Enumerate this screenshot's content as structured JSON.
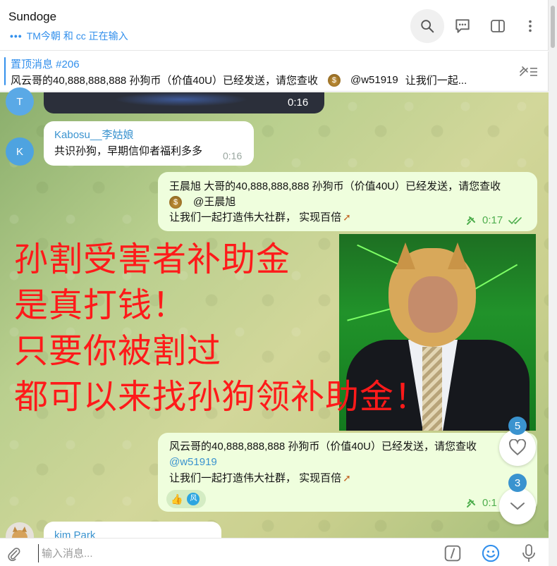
{
  "header": {
    "title": "Sundoge",
    "typing": "TM今朝 和 cc 正在输入"
  },
  "pinned": {
    "title": "置顶消息 #206",
    "text_before": "风云哥的40,888,888,888 孙狗币（价值40U）已经发送，请您查收",
    "mention": "@w51919",
    "text_after": "让我们一起..."
  },
  "messages": {
    "video_time": "0:16",
    "avatar_t": "T",
    "avatar_k": "K",
    "m1": {
      "sender": "Kabosu__李姑娘",
      "text": "共识孙狗，早期信仰者福利多多",
      "time": "0:16"
    },
    "m2": {
      "line1": "王晨旭 大哥的40,888,888,888 孙狗币（价值40U）已经发送，请您查收",
      "mention": "@王晨旭",
      "line3": "让我们一起打造伟大社群， 实现百倍",
      "time": "0:17"
    },
    "overlay": {
      "line1": "孙割受害者补助金",
      "line2": "是真打钱！",
      "line3": "只要你被割过",
      "line4": "都可以来找孙狗领补助金！"
    },
    "m3": {
      "line1": "风云哥的40,888,888,888 孙狗币（价值40U）已经发送，请您查收",
      "mention": "@w51919",
      "line3": "让我们一起打造伟大社群， 实现百倍",
      "time": "0:1",
      "reaction_emoji": "👍",
      "reaction_avatar": "风"
    },
    "m4": {
      "sender": "kim Park"
    }
  },
  "floating": {
    "reactions_count": "5",
    "unread_count": "3"
  },
  "composer": {
    "placeholder": "输入消息..."
  },
  "icons": {
    "search": "search-icon",
    "comments": "comments-icon",
    "sidebar": "sidebar-toggle-icon",
    "more": "more-vertical-icon",
    "pin_list": "pin-list-icon",
    "attach": "paperclip-icon",
    "command": "slash-command-icon",
    "emoji": "emoji-icon",
    "mic": "microphone-icon"
  },
  "colors": {
    "accent": "#3390ec",
    "outgoing": "#effedd",
    "overlay_red": "#ff1a1a"
  }
}
